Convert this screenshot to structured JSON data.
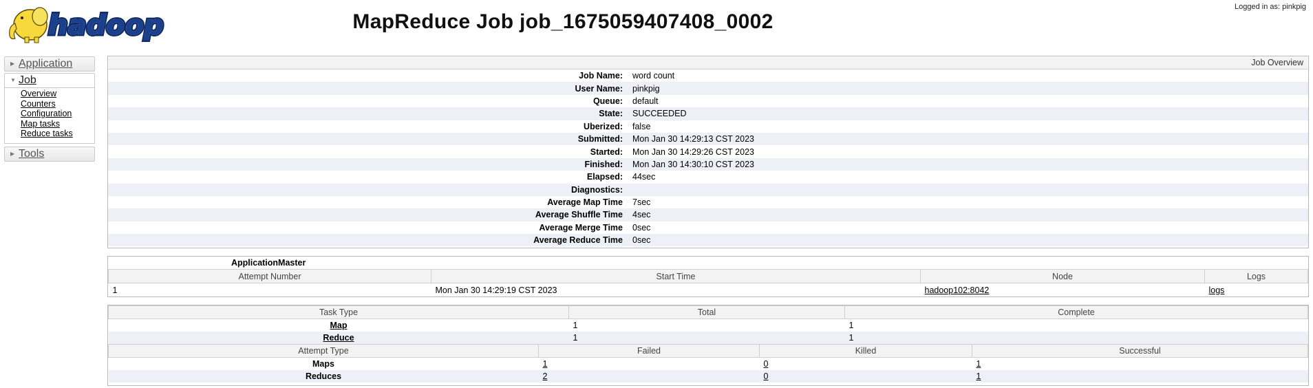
{
  "header": {
    "logo_alt": "hadoop",
    "title": "MapReduce Job job_1675059407408_0002",
    "logged_in": "Logged in as: pinkpig"
  },
  "nav": {
    "application": "Application",
    "job": "Job",
    "job_links": [
      "Overview",
      "Counters",
      "Configuration",
      "Map tasks",
      "Reduce tasks"
    ],
    "tools": "Tools",
    "collapsed_icon": "triangle-right-icon",
    "expanded_icon": "triangle-down-icon"
  },
  "overview": {
    "title": "Job Overview",
    "rows": [
      {
        "k": "Job Name:",
        "v": "word count"
      },
      {
        "k": "User Name:",
        "v": "pinkpig"
      },
      {
        "k": "Queue:",
        "v": "default"
      },
      {
        "k": "State:",
        "v": "SUCCEEDED"
      },
      {
        "k": "Uberized:",
        "v": "false"
      },
      {
        "k": "Submitted:",
        "v": "Mon Jan 30 14:29:13 CST 2023"
      },
      {
        "k": "Started:",
        "v": "Mon Jan 30 14:29:26 CST 2023"
      },
      {
        "k": "Finished:",
        "v": "Mon Jan 30 14:30:10 CST 2023"
      },
      {
        "k": "Elapsed:",
        "v": "44sec"
      },
      {
        "k": "Diagnostics:",
        "v": ""
      },
      {
        "k": "Average Map Time",
        "v": "7sec"
      },
      {
        "k": "Average Shuffle Time",
        "v": "4sec"
      },
      {
        "k": "Average Merge Time",
        "v": "0sec"
      },
      {
        "k": "Average Reduce Time",
        "v": "0sec"
      }
    ]
  },
  "app_master": {
    "title": "ApplicationMaster",
    "headers": [
      "Attempt Number",
      "Start Time",
      "Node",
      "Logs"
    ],
    "row": {
      "attempt": "1",
      "start": "Mon Jan 30 14:29:19 CST 2023",
      "node": "hadoop102:8042",
      "logs": "logs"
    }
  },
  "tasks": {
    "headers": [
      "Task Type",
      "Total",
      "Complete"
    ],
    "rows": [
      {
        "type": "Map",
        "total": "1",
        "complete": "1"
      },
      {
        "type": "Reduce",
        "total": "1",
        "complete": "1"
      }
    ],
    "attempt_headers": [
      "Attempt Type",
      "Failed",
      "Killed",
      "Successful"
    ],
    "attempt_rows": [
      {
        "type": "Maps",
        "failed": "1",
        "killed": "0",
        "successful": "1"
      },
      {
        "type": "Reduces",
        "failed": "2",
        "killed": "0",
        "successful": "1"
      }
    ]
  },
  "colors": {
    "stripe": "#eef0f8",
    "header_bg": "#f3f3f3",
    "border": "#b8b8b8",
    "logo_blue": "#1a3f8c",
    "logo_yellow": "#f7d93e"
  }
}
